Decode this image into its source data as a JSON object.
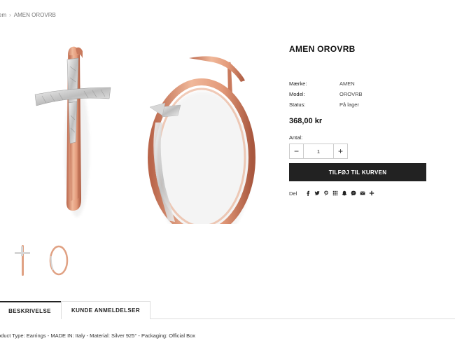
{
  "breadcrumb": {
    "previous": "em",
    "separator": "›",
    "current": "AMEN OROVRB"
  },
  "product": {
    "title": "AMEN OROVRB",
    "meta": [
      {
        "label": "Mærke:",
        "value": "AMEN"
      },
      {
        "label": "Model:",
        "value": "OROVRB"
      },
      {
        "label": "Status:",
        "value": "På lager"
      }
    ],
    "price": "368,00 kr",
    "quantity_label": "Antal:",
    "quantity_value": "1",
    "minus_symbol": "−",
    "plus_symbol": "+",
    "add_to_cart_label": "TILFØJ TIL KURVEN",
    "share_label": "Del",
    "share_icons": [
      "facebook-icon",
      "twitter-icon",
      "pinterest-icon",
      "grid-icon",
      "snapchat-icon",
      "messenger-icon",
      "email-icon",
      "plus-icon"
    ]
  },
  "tabs": [
    {
      "label": "BESKRIVELSE",
      "active": true
    },
    {
      "label": "KUNDE ANMELDELSER",
      "active": false
    }
  ],
  "description": "oduct Type: Earrings - MADE IN: Italy - Material: Silver 925° - Packaging: Official Box",
  "colors": {
    "rose_gold": "#d4876a",
    "silver": "#d8d8d8",
    "button_bg": "#222222"
  }
}
